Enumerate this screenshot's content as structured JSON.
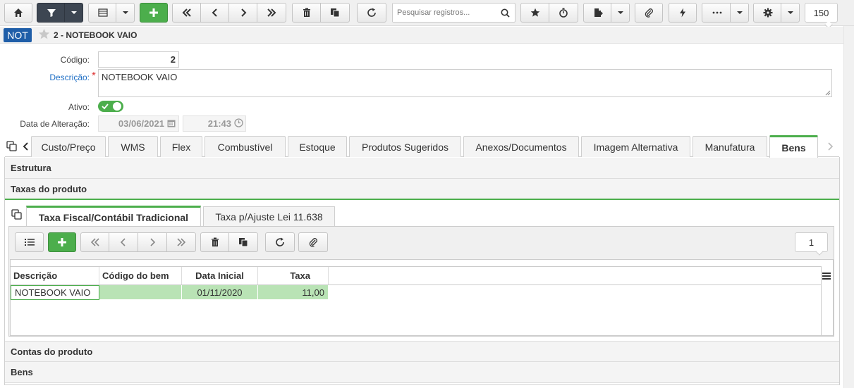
{
  "toolbar": {
    "search_placeholder": "Pesquisar registros...",
    "page_size": "150"
  },
  "header": {
    "badge": "NOT",
    "title": "2 - NOTEBOOK VAIO"
  },
  "form": {
    "codigo_label": "Código:",
    "codigo_value": "2",
    "descricao_label": "Descrição:",
    "descricao_required": "*",
    "descricao_value": "NOTEBOOK VAIO",
    "ativo_label": "Ativo:",
    "data_alteracao_label": "Data de Alteração:",
    "data_value": "03/06/2021",
    "hora_value": "21:43"
  },
  "tabs": [
    "Custo/Preço",
    "WMS",
    "Flex",
    "Combustível",
    "Estoque",
    "Produtos Sugeridos",
    "Anexos/Documentos",
    "Imagem Alternativa",
    "Manufatura",
    "Bens"
  ],
  "sections": {
    "estrutura": "Estrutura",
    "taxas": "Taxas do produto",
    "contas": "Contas do produto",
    "bens": "Bens"
  },
  "subtabs": [
    "Taxa Fiscal/Contábil Tradicional",
    "Taxa p/Ajuste Lei 11.638"
  ],
  "grid": {
    "page_size": "1",
    "columns": [
      "Descrição",
      "Código do bem",
      "Data Inicial",
      "Taxa"
    ],
    "rows": [
      {
        "descricao": "NOTEBOOK VAIO",
        "codigo": "",
        "data": "01/11/2020",
        "taxa": "11,00"
      }
    ]
  },
  "colors": {
    "accent_green": "#4cae4c",
    "badge_blue": "#1f5ea8",
    "filter_dark": "#3d4652",
    "selected_row": "#b9e3b5"
  }
}
